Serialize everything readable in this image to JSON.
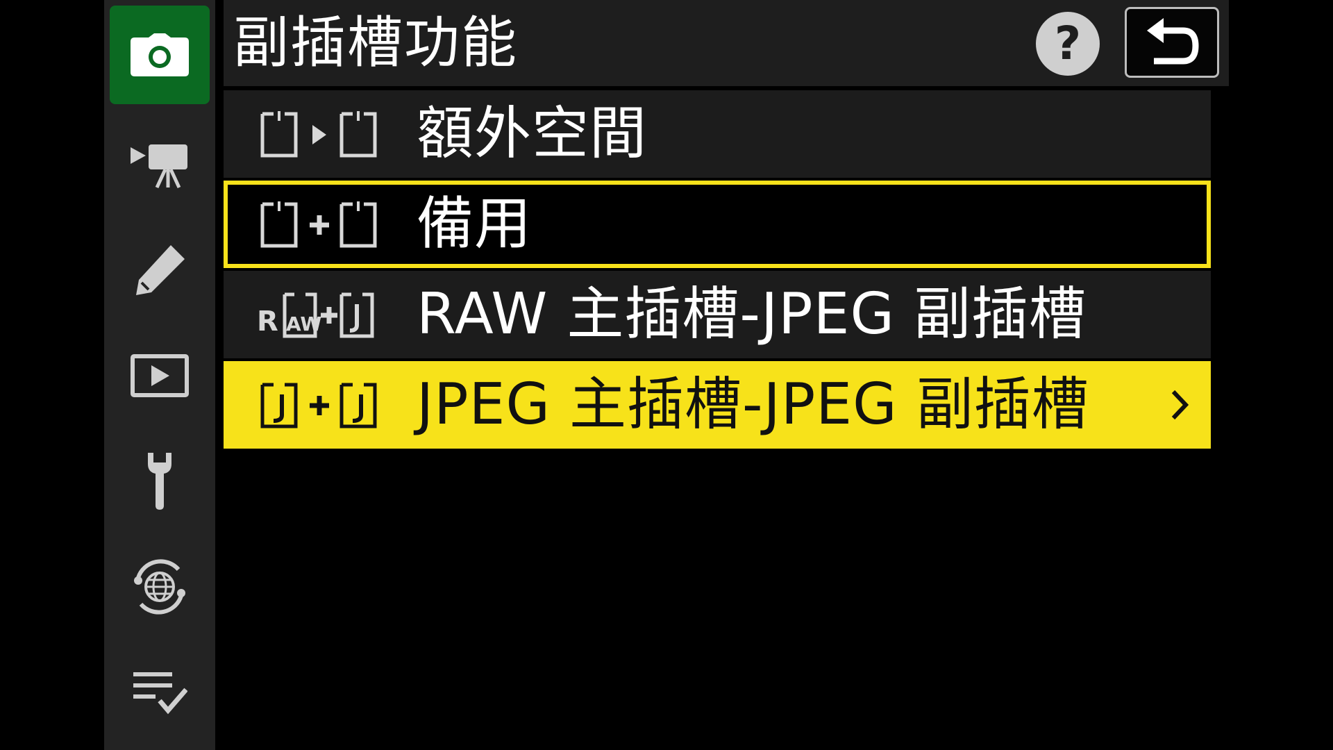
{
  "header": {
    "title": "副插槽功能",
    "help_label": "?"
  },
  "sidebar": {
    "items": [
      {
        "icon": "camera-icon",
        "active": true
      },
      {
        "icon": "movie-camera-icon",
        "active": false
      },
      {
        "icon": "pencil-icon",
        "active": false
      },
      {
        "icon": "playback-icon",
        "active": false
      },
      {
        "icon": "wrench-icon",
        "active": false
      },
      {
        "icon": "network-globe-icon",
        "active": false
      },
      {
        "icon": "my-menu-icon",
        "active": false
      }
    ]
  },
  "menu": {
    "items": [
      {
        "label": "額外空間",
        "icon": "overflow-slots-icon",
        "state": "normal"
      },
      {
        "label": "備用",
        "icon": "backup-slots-icon",
        "state": "focused"
      },
      {
        "label": "RAW 主插槽-JPEG 副插槽",
        "icon": "raw-plus-jpeg-icon",
        "state": "normal"
      },
      {
        "label": "JPEG 主插槽-JPEG 副插槽",
        "icon": "jpeg-plus-jpeg-icon",
        "state": "selected"
      }
    ]
  },
  "colors": {
    "background": "#000000",
    "sidebar": "#232323",
    "sidebar_active": "#0b6a22",
    "header": "#1e1e1e",
    "row": "#1c1c1c",
    "highlight": "#f7e21a",
    "text": "#ffffff"
  }
}
